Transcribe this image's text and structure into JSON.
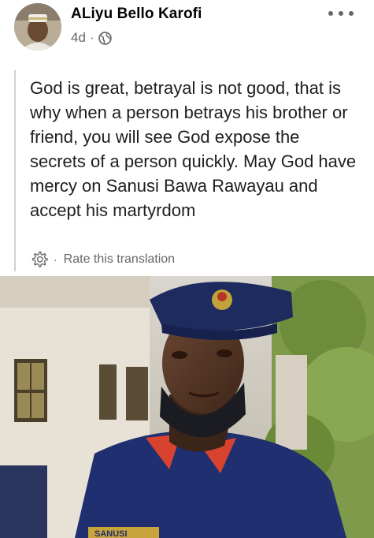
{
  "post": {
    "author": "ALiyu Bello Karofi",
    "time": "4d",
    "separator": "·",
    "audience_icon": "globe-icon",
    "more_icon": "more-options-icon",
    "text": "God is great, betrayal is not good, that is why when a person betrays his brother or friend, you will see God expose the secrets of a person quickly. May God have mercy on Sanusi Bawa Rawayau and accept his martyrdom",
    "translation": {
      "settings_icon": "gear-icon",
      "separator": "·",
      "rate_label": "Rate this translation"
    },
    "photo": {
      "alt_subject": "uniformed-officer-photo",
      "badge_text": "SANUSI"
    }
  },
  "colors": {
    "primary_text": "#050505",
    "secondary_text": "#65676b",
    "divider": "#ced0d4",
    "uniform_blue": "#1f2f6f",
    "collar_red": "#d8432f"
  }
}
